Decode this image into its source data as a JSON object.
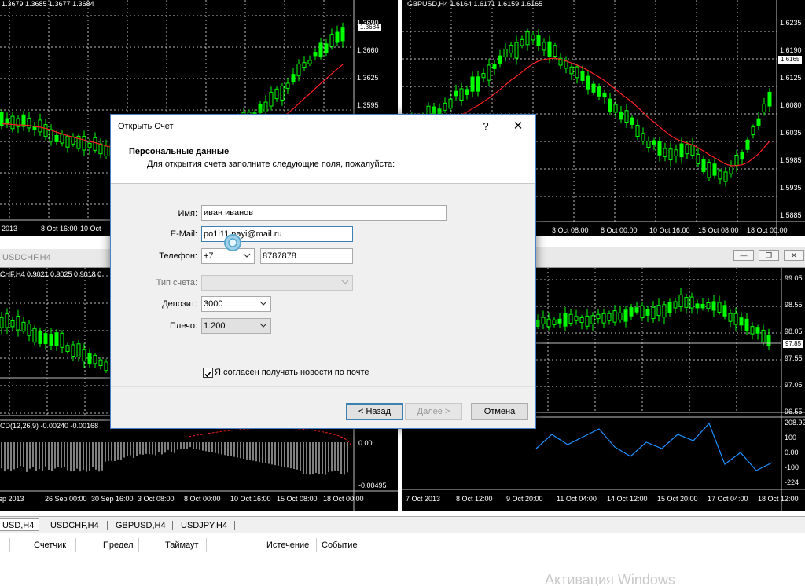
{
  "charts": {
    "eurusd": {
      "title": "1.3679 1.3685 1.3677 1.3684",
      "price_marker": "1.3684",
      "price_scale": [
        "1.3690",
        "1.3660",
        "1.3625",
        "1.3595"
      ],
      "time_scale": [
        "2013",
        "8 Oct 16:00",
        "10 Oct"
      ]
    },
    "gbpusd": {
      "title": "GBPUSD,H4  1.6164 1.6171 1.6159 1.6165",
      "price_marker": "1.6165",
      "price_scale": [
        "1.6235",
        "1.6190",
        "1.6125",
        "1.6080",
        "1.6035",
        "1.5985",
        "1.5935",
        "1.5885"
      ],
      "time_scale": [
        "3 Oct 08:00",
        "8 Oct 00:00",
        "10 Oct 16:00",
        "15 Oct 08:00",
        "18 Oct 00:00"
      ]
    },
    "usdchf": {
      "window_title": "USDCHF,H4",
      "title": "CHF,H4  0.9021 0.9025 0.9018 0",
      "macd_title": "CD(12,26,9) -0.00240 -0.00168",
      "macd_scale": [
        "0.00",
        "-0.00495"
      ],
      "time_scale": [
        "ep 2013",
        "26 Sep 00:00",
        "30 Sep 16:00",
        "3 Oct 08:00",
        "8 Oct 00:00",
        "10 Oct 16:00",
        "15 Oct 08:00",
        "18 Oct 00:00"
      ]
    },
    "usdjpy": {
      "price_marker": "97.85",
      "price_scale": [
        "99.05",
        "98.55",
        "98.05",
        "97.55",
        "97.05",
        "96.55"
      ],
      "cci_scale": [
        "208.92",
        "100",
        "0.00",
        "-100",
        "-224"
      ],
      "time_scale": [
        "7 Oct 2013",
        "8 Oct 12:00",
        "9 Oct 20:00",
        "11 Oct 04:00",
        "14 Oct 12:00",
        "15 Oct 20:00",
        "17 Oct 04:00",
        "18 Oct 12:00"
      ]
    }
  },
  "tabs": [
    "USD,H4",
    "USDCHF,H4",
    "GBPUSD,H4",
    "USDJPY,H4"
  ],
  "terminal_columns": [
    "Счетчик",
    "Предел",
    "Таймаут",
    "Истечение",
    "Событие"
  ],
  "watermark": "Активация Windows",
  "dialog": {
    "title": "Открыть Счет",
    "help": "?",
    "close": "✕",
    "header_title": "Персональные данные",
    "header_subtitle": "Для открытия счета заполните следующие поля, пожалуйста:",
    "fields": {
      "name_label": "Имя:",
      "name_value": "иван иванов",
      "email_label": "E-Mail:",
      "email_value": "po1i11 nayi@mail.ru",
      "phone_label": "Телефон:",
      "phone_code": "+7",
      "phone_value": "8787878",
      "account_type_label": "Тип счета:",
      "account_type_value": "",
      "deposit_label": "Депозит:",
      "deposit_value": "3000",
      "leverage_label": "Плечо:",
      "leverage_value": "1:200"
    },
    "newsletter_label": "Я согласен получать новости по почте",
    "newsletter_checked": true,
    "buttons": {
      "back": "< Назад",
      "next": "Далее >",
      "cancel": "Отмена"
    }
  },
  "colors": {
    "bull_candle": "#00ff00",
    "ma_line": "#ff0000",
    "cci_line": "#1e90ff",
    "grid": "#c0c0c0",
    "dialog_border": "#4a80c8"
  }
}
